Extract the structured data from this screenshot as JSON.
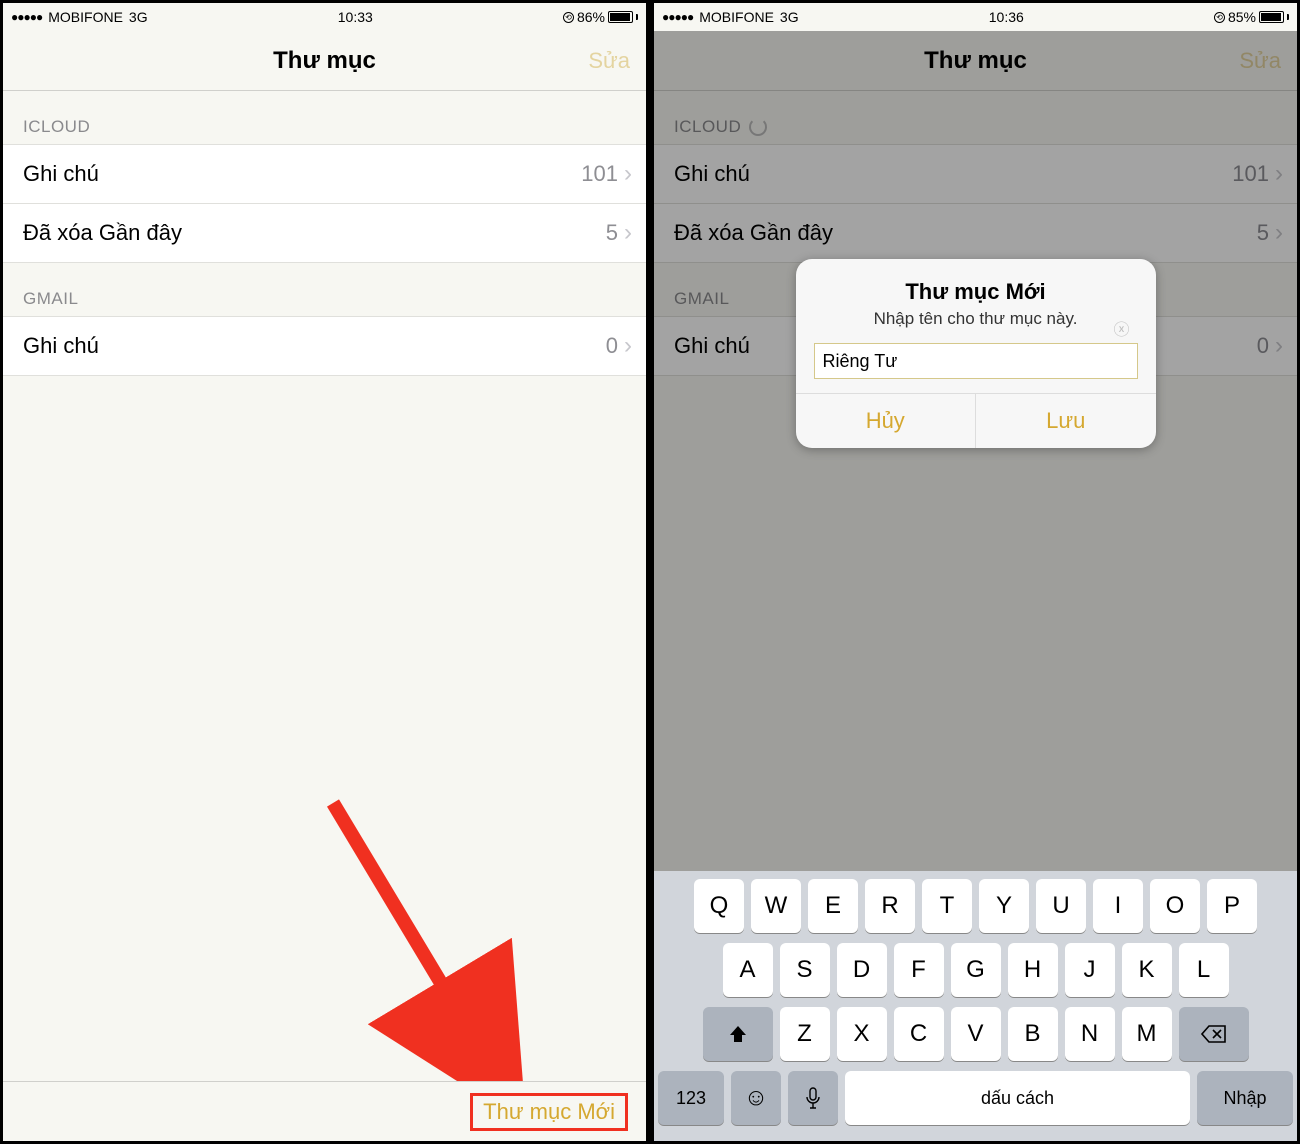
{
  "left": {
    "status": {
      "carrier": "MOBIFONE",
      "net": "3G",
      "time": "10:33",
      "batt": "86%",
      "fill": 86
    },
    "nav": {
      "title": "Thư mục",
      "edit": "Sửa"
    },
    "sections": [
      {
        "header": "ICLOUD",
        "rows": [
          {
            "label": "Ghi chú",
            "count": "101"
          },
          {
            "label": "Đã xóa Gần đây",
            "count": "5"
          }
        ]
      },
      {
        "header": "GMAIL",
        "rows": [
          {
            "label": "Ghi chú",
            "count": "0"
          }
        ]
      }
    ],
    "toolbar": {
      "new_folder": "Thư mục Mới"
    }
  },
  "right": {
    "status": {
      "carrier": "MOBIFONE",
      "net": "3G",
      "time": "10:36",
      "batt": "85%",
      "fill": 85
    },
    "nav": {
      "title": "Thư mục",
      "edit": "Sửa"
    },
    "sections": [
      {
        "header": "ICLOUD",
        "rows": [
          {
            "label": "Ghi chú",
            "count": "101"
          },
          {
            "label": "Đã xóa Gần đây",
            "count": "5"
          }
        ]
      },
      {
        "header": "GMAIL",
        "rows": [
          {
            "label": "Ghi chú",
            "count": "0"
          }
        ]
      }
    ],
    "alert": {
      "title": "Thư mục Mới",
      "msg": "Nhập tên cho thư mục này.",
      "value": "Riêng Tư",
      "cancel": "Hủy",
      "save": "Lưu"
    },
    "keyboard": {
      "r1": [
        "Q",
        "W",
        "E",
        "R",
        "T",
        "Y",
        "U",
        "I",
        "O",
        "P"
      ],
      "r2": [
        "A",
        "S",
        "D",
        "F",
        "G",
        "H",
        "J",
        "K",
        "L"
      ],
      "r3": [
        "Z",
        "X",
        "C",
        "V",
        "B",
        "N",
        "M"
      ],
      "num": "123",
      "space": "dấu cách",
      "return": "Nhập"
    }
  }
}
